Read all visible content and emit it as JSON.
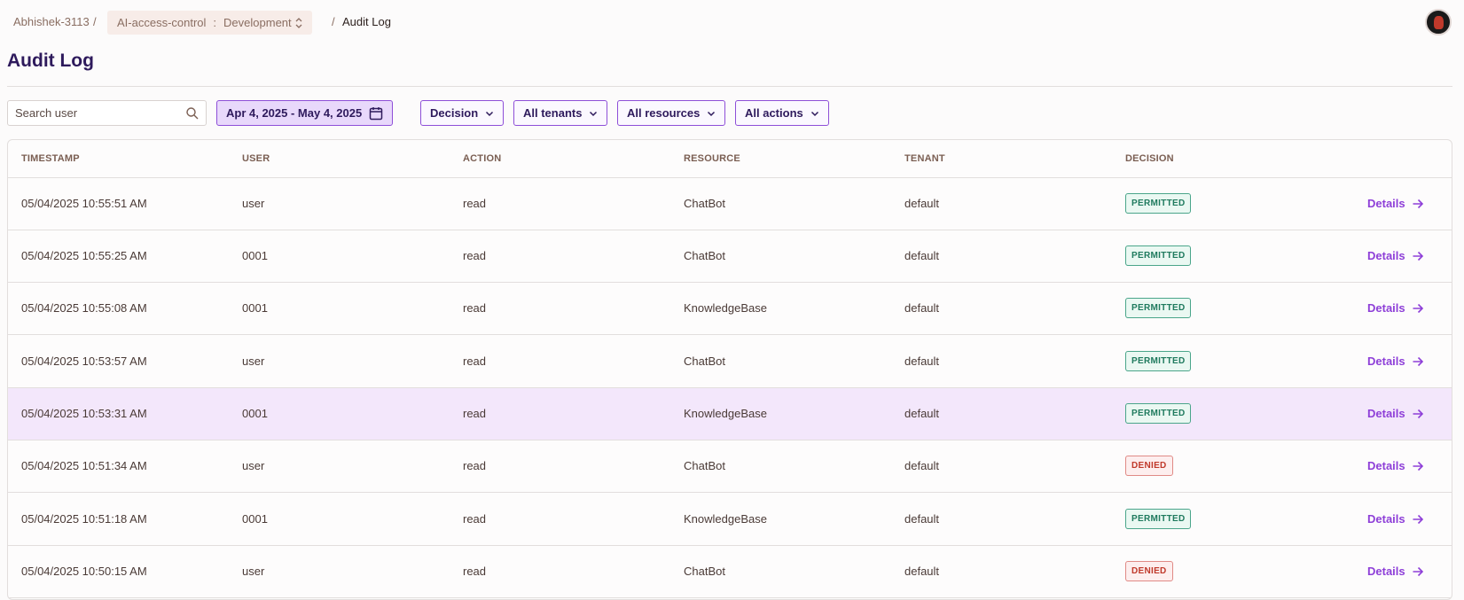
{
  "breadcrumb": {
    "user": "Abhishek-3113",
    "separator": "/",
    "project": "AI-access-control",
    "colon": ":",
    "environment": "Development",
    "current": "Audit Log"
  },
  "page": {
    "title": "Audit Log"
  },
  "filters": {
    "search_placeholder": "Search user",
    "date_range": "Apr 4, 2025 - May 4, 2025",
    "decision": "Decision",
    "tenants": "All tenants",
    "resources": "All resources",
    "actions": "All actions"
  },
  "table": {
    "headers": [
      "TIMESTAMP",
      "USER",
      "ACTION",
      "RESOURCE",
      "TENANT",
      "DECISION"
    ],
    "details_label": "Details",
    "rows": [
      {
        "timestamp": "05/04/2025 10:55:51 AM",
        "user": "user",
        "action": "read",
        "resource": "ChatBot",
        "tenant": "default",
        "decision": "PERMITTED"
      },
      {
        "timestamp": "05/04/2025 10:55:25 AM",
        "user": "0001",
        "action": "read",
        "resource": "ChatBot",
        "tenant": "default",
        "decision": "PERMITTED"
      },
      {
        "timestamp": "05/04/2025 10:55:08 AM",
        "user": "0001",
        "action": "read",
        "resource": "KnowledgeBase",
        "tenant": "default",
        "decision": "PERMITTED"
      },
      {
        "timestamp": "05/04/2025 10:53:57 AM",
        "user": "user",
        "action": "read",
        "resource": "ChatBot",
        "tenant": "default",
        "decision": "PERMITTED"
      },
      {
        "timestamp": "05/04/2025 10:53:31 AM",
        "user": "0001",
        "action": "read",
        "resource": "KnowledgeBase",
        "tenant": "default",
        "decision": "PERMITTED"
      },
      {
        "timestamp": "05/04/2025 10:51:34 AM",
        "user": "user",
        "action": "read",
        "resource": "ChatBot",
        "tenant": "default",
        "decision": "DENIED"
      },
      {
        "timestamp": "05/04/2025 10:51:18 AM",
        "user": "0001",
        "action": "read",
        "resource": "KnowledgeBase",
        "tenant": "default",
        "decision": "PERMITTED"
      },
      {
        "timestamp": "05/04/2025 10:50:15 AM",
        "user": "user",
        "action": "read",
        "resource": "ChatBot",
        "tenant": "default",
        "decision": "DENIED"
      }
    ]
  },
  "colors": {
    "accent": "#8e3fd8",
    "title": "#2e1a5c",
    "permitted": "#1f7a5e",
    "denied": "#c0392b",
    "highlight_row": "#f3e7fb"
  },
  "icons": [
    "search-icon",
    "calendar-icon",
    "chevron-down-icon",
    "up-down-icon",
    "arrow-right-icon"
  ]
}
